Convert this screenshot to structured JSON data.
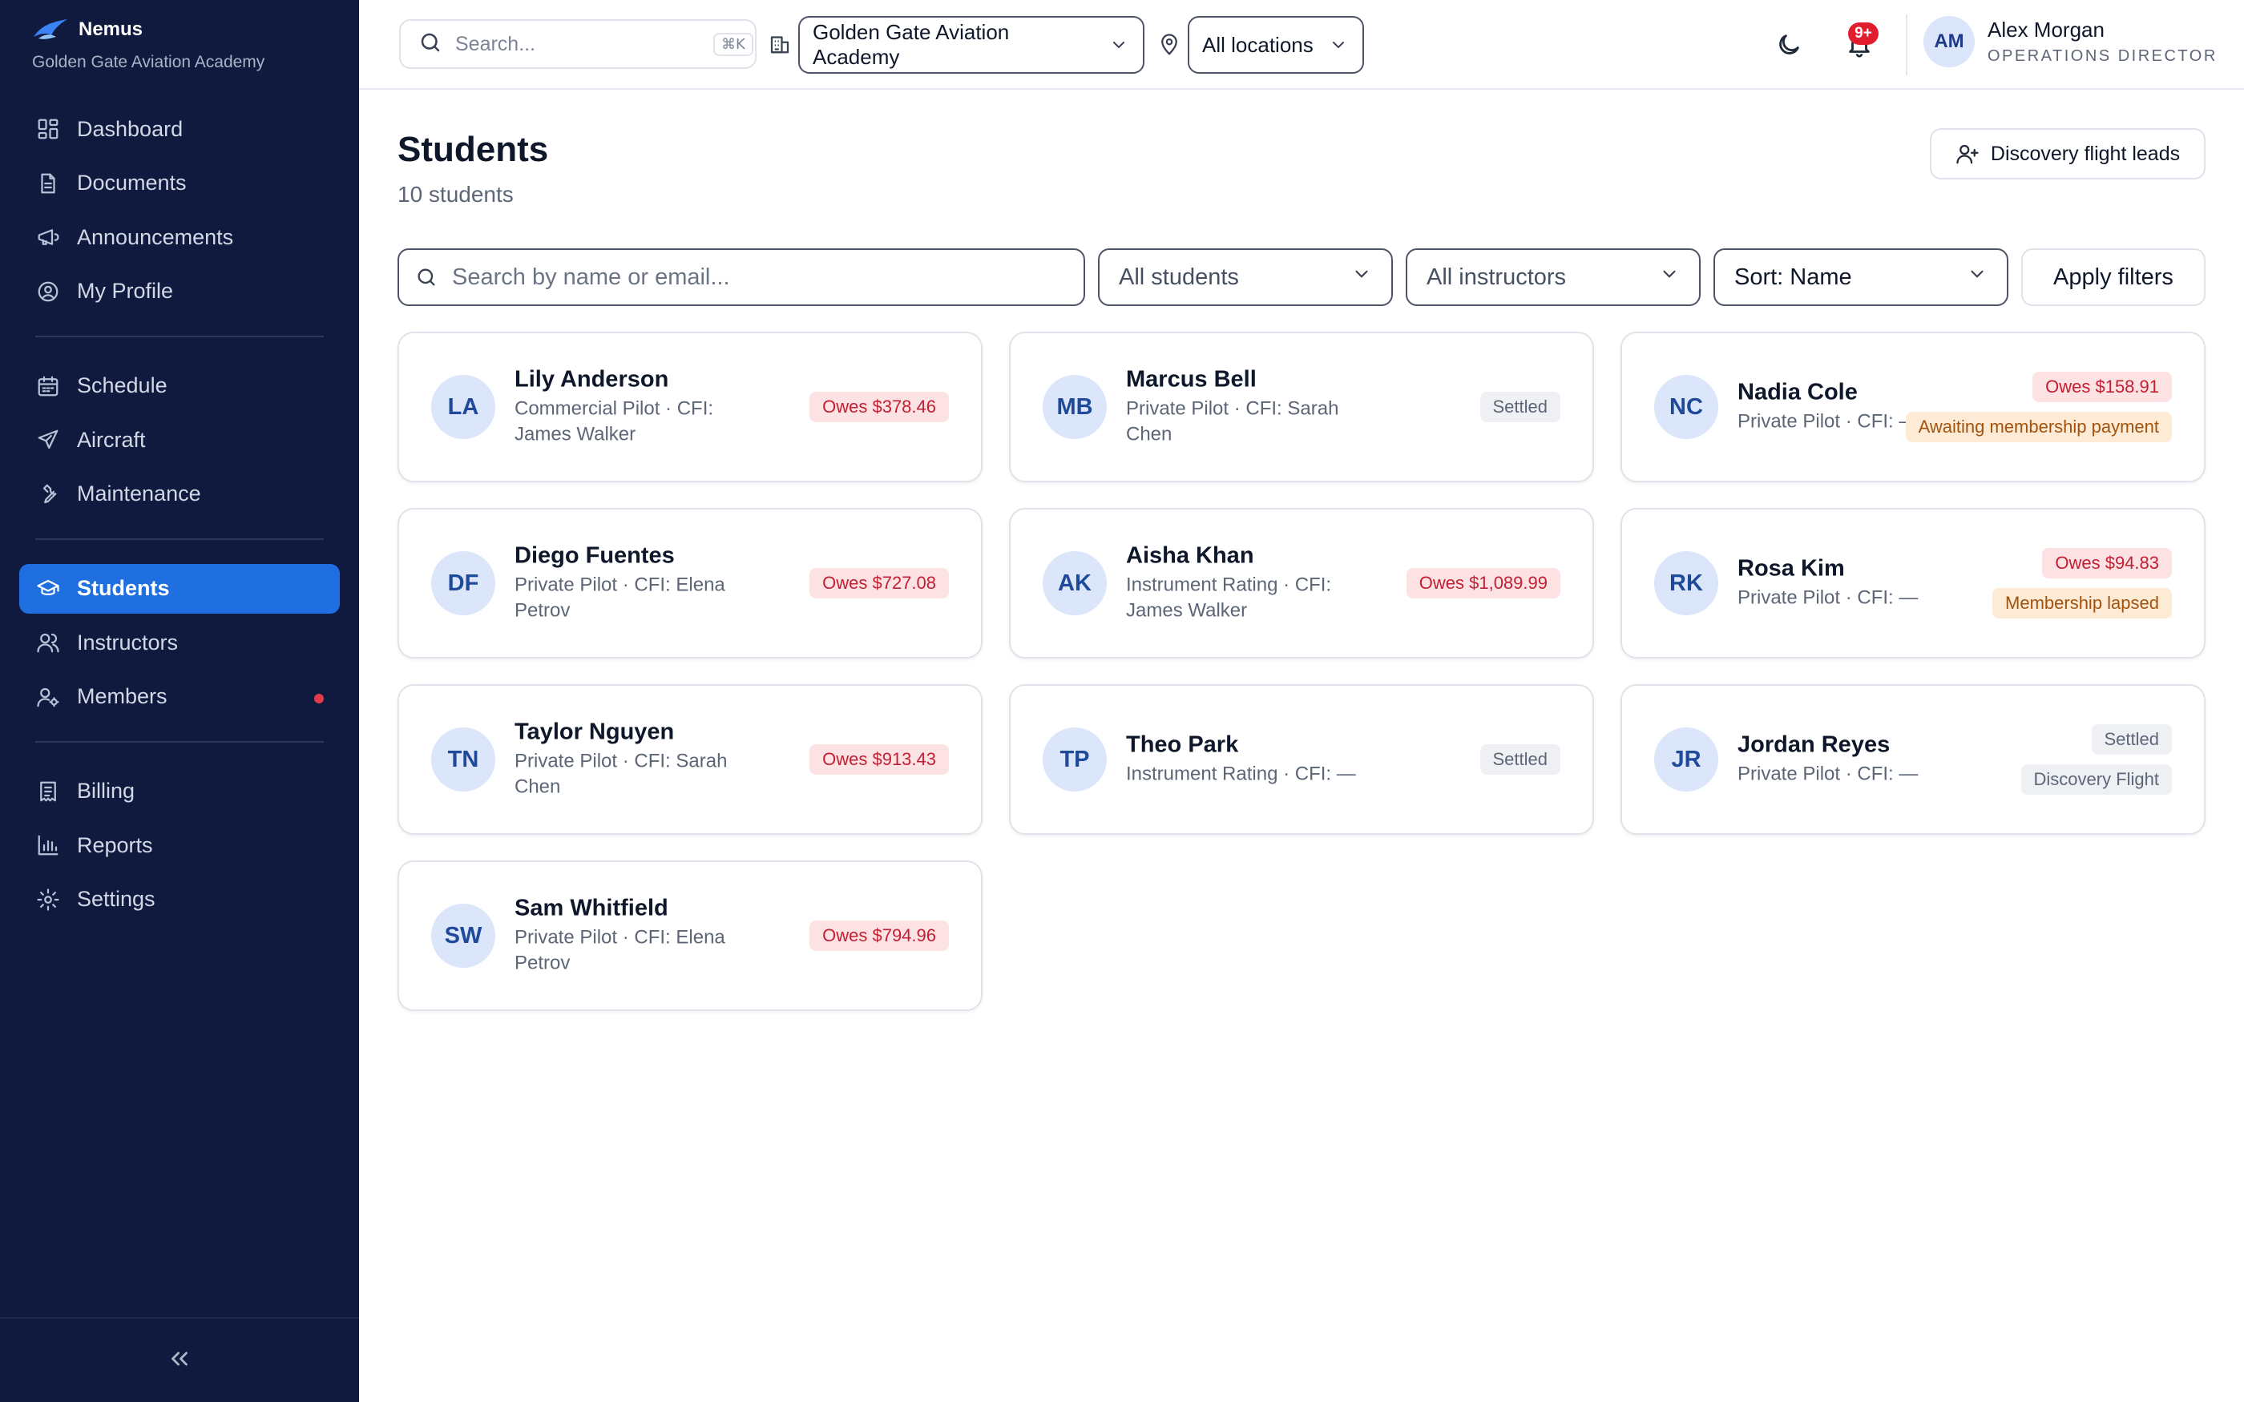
{
  "brand": {
    "name": "Nemus",
    "org": "Golden Gate Aviation Academy"
  },
  "nav": {
    "groups": [
      [
        {
          "id": "dashboard",
          "label": "Dashboard",
          "icon": "dashboard-icon"
        },
        {
          "id": "documents",
          "label": "Documents",
          "icon": "document-icon"
        },
        {
          "id": "announcements",
          "label": "Announcements",
          "icon": "megaphone-icon"
        },
        {
          "id": "my-profile",
          "label": "My Profile",
          "icon": "user-circle-icon"
        }
      ],
      [
        {
          "id": "schedule",
          "label": "Schedule",
          "icon": "calendar-icon"
        },
        {
          "id": "aircraft",
          "label": "Aircraft",
          "icon": "plane-icon"
        },
        {
          "id": "maintenance",
          "label": "Maintenance",
          "icon": "wrench-icon"
        }
      ],
      [
        {
          "id": "students",
          "label": "Students",
          "icon": "graduation-cap-icon",
          "active": true
        },
        {
          "id": "instructors",
          "label": "Instructors",
          "icon": "users-icon"
        },
        {
          "id": "members",
          "label": "Members",
          "icon": "user-cog-icon",
          "dot": true
        }
      ],
      [
        {
          "id": "billing",
          "label": "Billing",
          "icon": "receipt-icon"
        },
        {
          "id": "reports",
          "label": "Reports",
          "icon": "bar-chart-icon"
        },
        {
          "id": "settings",
          "label": "Settings",
          "icon": "gear-icon"
        }
      ]
    ],
    "dot_color": "#e23a4a"
  },
  "topbar": {
    "search_placeholder": "Search...",
    "search_shortcut": "⌘K",
    "org_select": "Golden Gate Aviation Academy",
    "location_select": "All locations",
    "notifications_badge": "9+",
    "user": {
      "initials": "AM",
      "name": "Alex Morgan",
      "role": "OPERATIONS DIRECTOR"
    }
  },
  "page": {
    "title": "Students",
    "count": "10 students",
    "leads_button": "Discovery flight leads"
  },
  "filters": {
    "search_placeholder": "Search by name or email...",
    "status": "All students",
    "instructor": "All instructors",
    "sort": "Sort: Name",
    "apply": "Apply filters"
  },
  "colors": {
    "sidebar_bg": "#0f1a3e",
    "accent": "#1f6fe0",
    "owes_bg": "#fde2e4",
    "owes_text": "#c21f33",
    "warn_bg": "#fdebd5",
    "warn_text": "#a2520e"
  },
  "students": [
    {
      "initials": "LA",
      "name": "Lily Anderson",
      "meta": "Commercial Pilot · CFI: James Walker",
      "badges": [
        {
          "text": "Owes $378.46",
          "kind": "owes"
        }
      ]
    },
    {
      "initials": "MB",
      "name": "Marcus Bell",
      "meta": "Private Pilot · CFI: Sarah Chen",
      "badges": [
        {
          "text": "Settled",
          "kind": "settled"
        }
      ]
    },
    {
      "initials": "NC",
      "name": "Nadia Cole",
      "meta": "Private Pilot · CFI: —",
      "badges": [
        {
          "text": "Owes $158.91",
          "kind": "owes"
        },
        {
          "text": "Awaiting membership payment",
          "kind": "warn"
        }
      ]
    },
    {
      "initials": "DF",
      "name": "Diego Fuentes",
      "meta": "Private Pilot · CFI: Elena Petrov",
      "badges": [
        {
          "text": "Owes $727.08",
          "kind": "owes"
        }
      ]
    },
    {
      "initials": "AK",
      "name": "Aisha Khan",
      "meta": "Instrument Rating · CFI: James Walker",
      "badges": [
        {
          "text": "Owes $1,089.99",
          "kind": "owes"
        }
      ]
    },
    {
      "initials": "RK",
      "name": "Rosa Kim",
      "meta": "Private Pilot · CFI: —",
      "badges": [
        {
          "text": "Owes $94.83",
          "kind": "owes"
        },
        {
          "text": "Membership lapsed",
          "kind": "warn"
        }
      ]
    },
    {
      "initials": "TN",
      "name": "Taylor Nguyen",
      "meta": "Private Pilot · CFI: Sarah Chen",
      "badges": [
        {
          "text": "Owes $913.43",
          "kind": "owes"
        }
      ]
    },
    {
      "initials": "TP",
      "name": "Theo Park",
      "meta": "Instrument Rating · CFI: —",
      "badges": [
        {
          "text": "Settled",
          "kind": "settled"
        }
      ]
    },
    {
      "initials": "JR",
      "name": "Jordan Reyes",
      "meta": "Private Pilot · CFI: —",
      "badges": [
        {
          "text": "Settled",
          "kind": "settled"
        },
        {
          "text": "Discovery Flight",
          "kind": "settled"
        }
      ]
    },
    {
      "initials": "SW",
      "name": "Sam Whitfield",
      "meta": "Private Pilot · CFI: Elena Petrov",
      "badges": [
        {
          "text": "Owes $794.96",
          "kind": "owes"
        }
      ]
    }
  ]
}
